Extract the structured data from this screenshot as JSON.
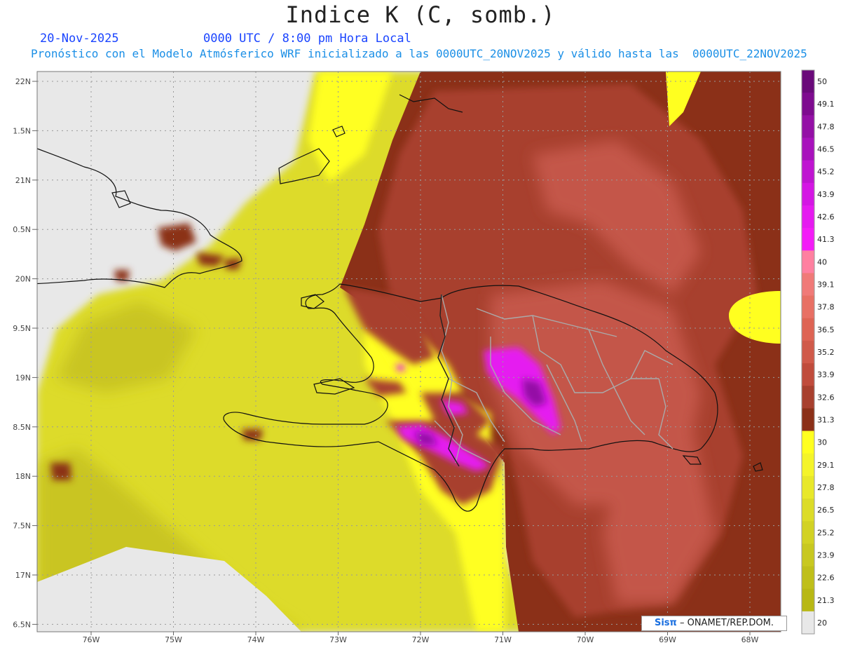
{
  "title": "Indice K (C, somb.)",
  "date_label": "20-Nov-2025",
  "time_label": "0000 UTC / 8:00 pm Hora Local",
  "subtitle": "Pronóstico con el Modelo Atmósferico WRF inicializado a las 0000UTC_20NOV2025 y válido hasta las  0000UTC_22NOV2025",
  "credit": {
    "brand": "Sisπ",
    "text": "– ONAMET/REP.DOM."
  },
  "lat_labels": [
    "22N",
    "1.5N",
    "21N",
    "0.5N",
    "20N",
    "9.5N",
    "19N",
    "8.5N",
    "18N",
    "7.5N",
    "17N",
    "6.5N"
  ],
  "lon_labels": [
    "76W",
    "75W",
    "74W",
    "73W",
    "72W",
    "71W",
    "70W",
    "69W",
    "68W"
  ],
  "colorbar": {
    "labels": [
      "50",
      "49.1",
      "47.8",
      "46.5",
      "45.2",
      "43.9",
      "42.6",
      "41.3",
      "40",
      "39.1",
      "37.8",
      "36.5",
      "35.2",
      "33.9",
      "32.6",
      "31.3",
      "30",
      "29.1",
      "27.8",
      "26.5",
      "25.2",
      "23.9",
      "22.6",
      "21.3",
      "20"
    ],
    "colors": [
      "#6a0a7a",
      "#7e0b8f",
      "#9410a6",
      "#a812bc",
      "#bf14d1",
      "#d416e4",
      "#e51af0",
      "#f31cf7",
      "#ff80a0",
      "#f07a78",
      "#e87064",
      "#de6454",
      "#d05a4a",
      "#c04c3c",
      "#a8402e",
      "#8b3018",
      "#ffff20",
      "#f4f42a",
      "#e8e82a",
      "#dcdc28",
      "#d2d224",
      "#c8c820",
      "#bfbf1a",
      "#b8b814",
      "#e8e8e8"
    ]
  },
  "map_colors": {
    "below20": "#e8e8e8",
    "yellow_dark": "#c9c520",
    "yellow_mid": "#dddb2a",
    "yellow_bright": "#ffff20",
    "brown_dark": "#8b3018",
    "brown_mid": "#a8402e",
    "brown_light": "#c4574a",
    "brown_pale": "#d0655a",
    "magenta": "#e51af0",
    "purple": "#9410a6"
  }
}
